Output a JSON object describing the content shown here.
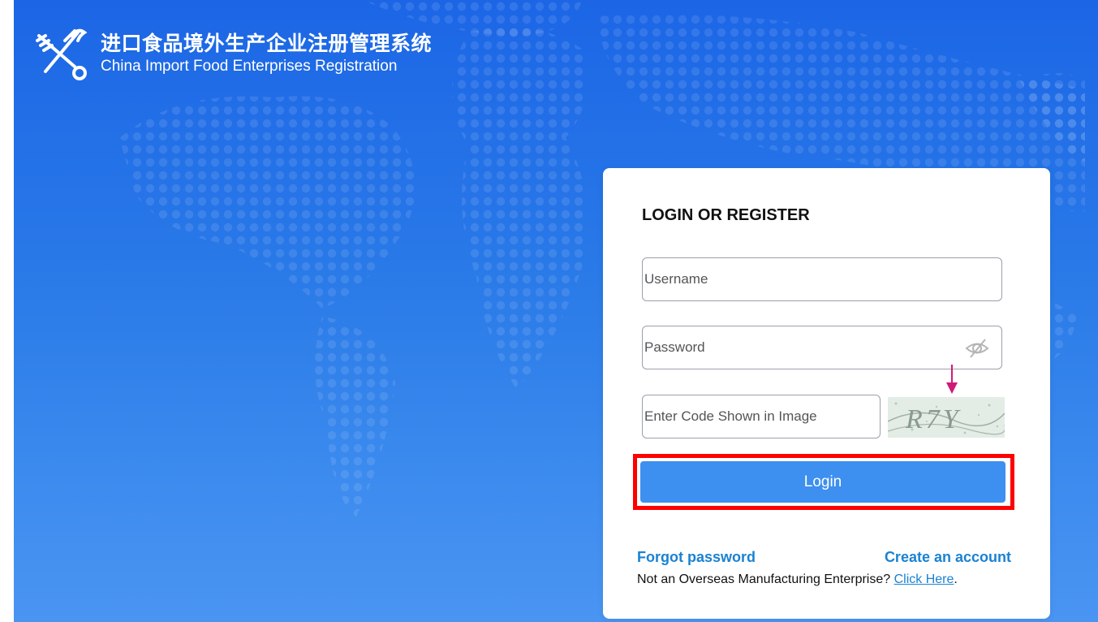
{
  "header": {
    "title_cn": "进口食品境外生产企业注册管理系统",
    "title_en": "China Import Food Enterprises Registration"
  },
  "login": {
    "heading": "LOGIN OR REGISTER",
    "username_placeholder": "Username",
    "password_placeholder": "Password",
    "code_placeholder": "Enter Code Shown in Image",
    "captcha_text": "R7Y",
    "login_label": "Login",
    "forgot_label": "Forgot password",
    "create_label": "Create an account",
    "note_text": "Not an Overseas Manufacturing Enterprise? ",
    "note_link": "Click Here",
    "note_end": "."
  },
  "colors": {
    "brand_blue": "#2a7ae8",
    "button_blue": "#3d8ff0",
    "link_blue": "#1a82d2",
    "highlight_red": "#ff0000",
    "annotation_pink": "#d01a7a"
  },
  "icons": {
    "logo": "caduceus-key-logo-icon",
    "password_toggle": "eye-slash-icon",
    "annotation": "arrow-down-icon"
  }
}
